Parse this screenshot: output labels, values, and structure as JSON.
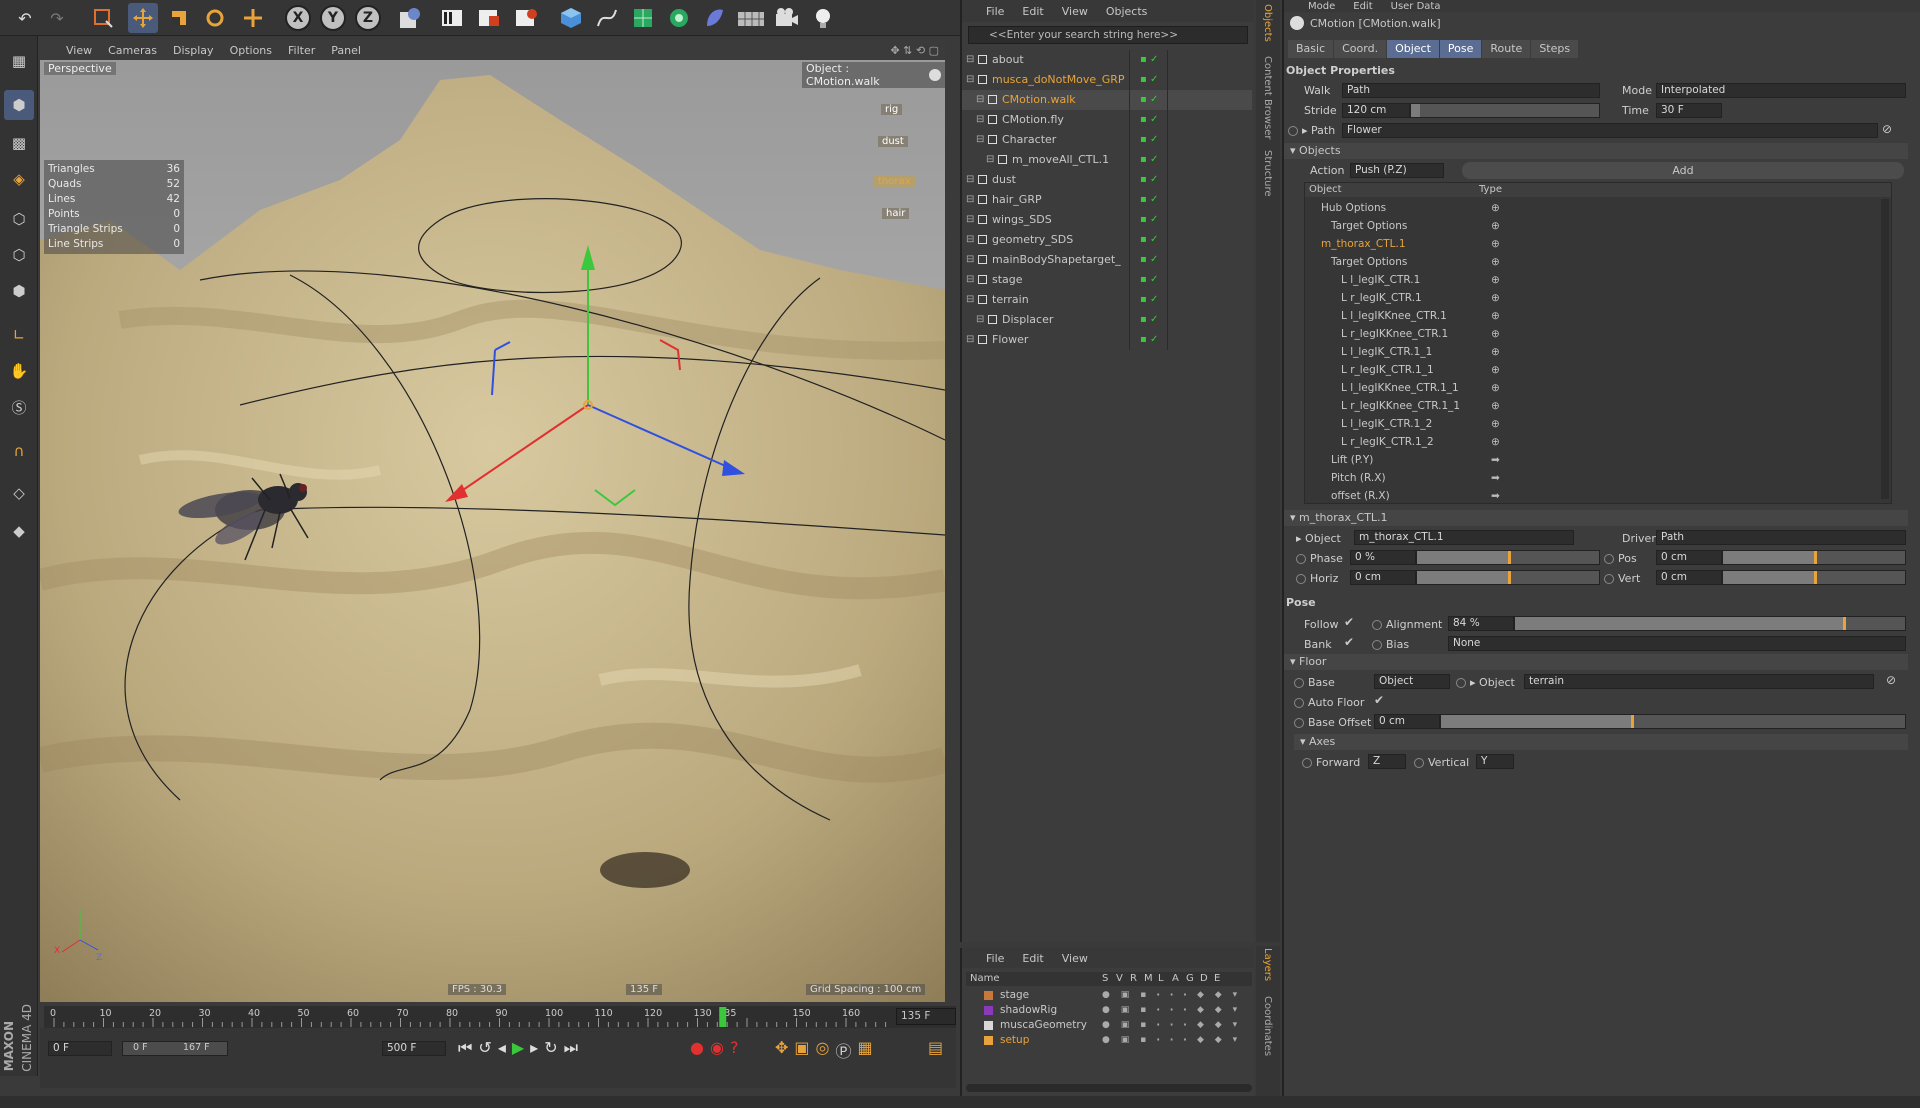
{
  "app": {
    "brand_top": "MAXON",
    "brand_bottom": "CINEMA 4D"
  },
  "top_toolbar": {
    "icons": [
      "undo-icon",
      "redo-icon",
      "live-selection-icon",
      "move-icon",
      "scale-icon",
      "rotate-icon",
      "recent-tool-icon",
      "x-axis-icon",
      "y-axis-icon",
      "z-axis-icon",
      "world-coordinates-icon",
      "render-view-icon",
      "render-picture-viewer-icon",
      "render-settings-icon",
      "cube-icon",
      "pen-spline-icon",
      "subdivision-icon",
      "array-icon",
      "deformer-icon",
      "floor-icon",
      "camera-icon",
      "light-icon"
    ],
    "axis_letters": [
      "X",
      "Y",
      "Z"
    ]
  },
  "viewport": {
    "menu": [
      "View",
      "Cameras",
      "Display",
      "Options",
      "Filter",
      "Panel"
    ],
    "name": "Perspective",
    "object_label": "Object : CMotion.walk",
    "stats": [
      {
        "k": "Triangles",
        "v": "36"
      },
      {
        "k": "Quads",
        "v": "52"
      },
      {
        "k": "Lines",
        "v": "42"
      },
      {
        "k": "Points",
        "v": "0"
      },
      {
        "k": "Triangle Strips",
        "v": "0"
      },
      {
        "k": "Line Strips",
        "v": "0"
      }
    ],
    "fps": "FPS : 30.3",
    "frame": "135 F",
    "grid": "Grid Spacing : 100 cm",
    "overlay_buttons": [
      "rig",
      "dust",
      "thorax",
      "hair"
    ]
  },
  "timeline": {
    "ticks": [
      "0",
      "10",
      "20",
      "30",
      "40",
      "50",
      "60",
      "70",
      "80",
      "90",
      "100",
      "110",
      "120",
      "130",
      "135",
      "150",
      "160"
    ],
    "current": "135 F",
    "start": "0 F",
    "range_start": "0 F",
    "range_end": "167 F",
    "end": "500 F"
  },
  "object_manager": {
    "menu": [
      "File",
      "Edit",
      "View",
      "Objects"
    ],
    "search_placeholder": "<<Enter your search string here>>",
    "items": [
      {
        "name": "about",
        "depth": 0,
        "color": "normal"
      },
      {
        "name": "musca_doNotMove_GRP",
        "depth": 0,
        "color": "orange"
      },
      {
        "name": "CMotion.walk",
        "depth": 1,
        "color": "orange"
      },
      {
        "name": "CMotion.fly",
        "depth": 1,
        "color": "normal"
      },
      {
        "name": "Character",
        "depth": 1,
        "color": "normal"
      },
      {
        "name": "m_moveAll_CTL.1",
        "depth": 2,
        "color": "normal"
      },
      {
        "name": "dust",
        "depth": 0,
        "color": "normal"
      },
      {
        "name": "hair_GRP",
        "depth": 0,
        "color": "normal"
      },
      {
        "name": "wings_SDS",
        "depth": 0,
        "color": "normal"
      },
      {
        "name": "geometry_SDS",
        "depth": 0,
        "color": "normal"
      },
      {
        "name": "mainBodyShapetarget_",
        "depth": 0,
        "color": "normal"
      },
      {
        "name": "stage",
        "depth": 0,
        "color": "normal"
      },
      {
        "name": "terrain",
        "depth": 0,
        "color": "normal"
      },
      {
        "name": "Displacer",
        "depth": 1,
        "color": "normal"
      },
      {
        "name": "Flower",
        "depth": 0,
        "color": "normal"
      }
    ]
  },
  "side_tabs": [
    "Objects",
    "Content Browser",
    "Structure"
  ],
  "side_tabs_bottom": [
    "Layers",
    "Coordinates"
  ],
  "layer_manager": {
    "menu": [
      "File",
      "Edit",
      "View"
    ],
    "columns": [
      "Name",
      "S",
      "V",
      "R",
      "M",
      "L",
      "A",
      "G",
      "D",
      "E"
    ],
    "layers": [
      {
        "name": "stage",
        "color": "#c8783a"
      },
      {
        "name": "shadowRig",
        "color": "#8a3ab8"
      },
      {
        "name": "muscaGeometry",
        "color": "#d8d8d8"
      },
      {
        "name": "setup",
        "color": "#e8a33a"
      }
    ]
  },
  "attributes": {
    "menu": [
      "Mode",
      "Edit",
      "User Data"
    ],
    "title": "CMotion [CMotion.walk]",
    "tabs": [
      "Basic",
      "Coord.",
      "Object",
      "Pose",
      "Route",
      "Steps"
    ],
    "section_object": "Object Properties",
    "walk_label": "Walk",
    "walk_value": "Path",
    "mode_label": "Mode",
    "mode_value": "Interpolated",
    "stride_label": "Stride",
    "stride_value": "120 cm",
    "time_label": "Time",
    "time_value": "30 F",
    "path_label": "Path",
    "path_value": "Flower",
    "objects_section": "Objects",
    "action_label": "Action",
    "action_value": "Push (P.Z)",
    "add_label": "Add",
    "tree_headers": [
      "Object",
      "Type"
    ],
    "tree": [
      "Hub Options",
      "Target Options",
      "m_thorax_CTL.1",
      "Target Options",
      "l_legIK_CTR.1",
      "r_legIK_CTR.1",
      "l_legIKKnee_CTR.1",
      "r_legIKKnee_CTR.1",
      "l_legIK_CTR.1_1",
      "r_legIK_CTR.1_1",
      "l_legIKKnee_CTR.1_1",
      "r_legIKKnee_CTR.1_1",
      "l_legIK_CTR.1_2",
      "r_legIK_CTR.1_2",
      "Lift (P.Y)",
      "Pitch (R.X)",
      "offset (R.X)"
    ],
    "thorax_section": "m_thorax_CTL.1",
    "object_label": "Object",
    "object_value": "m_thorax_CTL.1",
    "driver_label": "Driver",
    "driver_value": "Path",
    "phase_label": "Phase",
    "phase_value": "0 %",
    "pos_label": "Pos",
    "pos_value": "0 cm",
    "horiz_label": "Horiz",
    "horiz_value": "0 cm",
    "vert_label": "Vert",
    "vert_value": "0 cm",
    "pose_section": "Pose",
    "follow_label": "Follow",
    "alignment_label": "Alignment",
    "alignment_value": "84 %",
    "bank_label": "Bank",
    "bias_label": "Bias",
    "bias_value": "None",
    "floor_section": "Floor",
    "base_label": "Base",
    "base_value": "Object",
    "floor_object_label": "Object",
    "floor_object_value": "terrain",
    "autofloor_label": "Auto Floor",
    "baseoffset_label": "Base Offset",
    "baseoffset_value": "0 cm",
    "axes_section": "Axes",
    "forward_label": "Forward",
    "forward_value": "Z",
    "vertical_label": "Vertical",
    "vertical_value": "Y"
  },
  "colors": {
    "accent": "#e8a33a",
    "tab_active": "#5c6d94",
    "panel": "#3c3c3c",
    "viewport_sky": "#b8b8b8",
    "terrain": "#c9b88e"
  },
  "values": {
    "alignment_fraction": 0.84,
    "stride_fraction": 0.05,
    "playhead_frame": 135
  }
}
